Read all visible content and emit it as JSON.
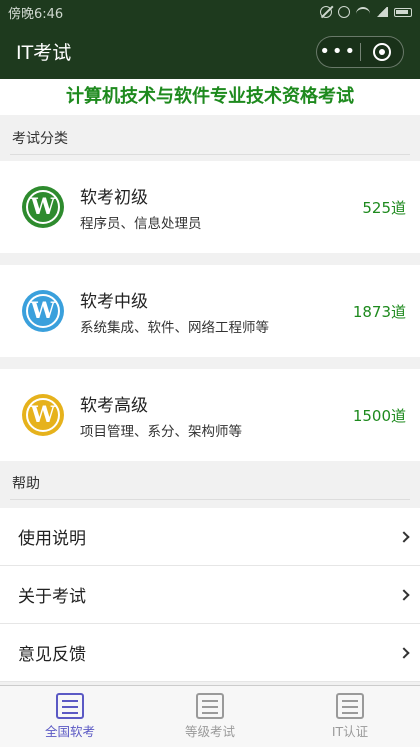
{
  "status": {
    "time": "傍晚6:46"
  },
  "nav": {
    "title": "IT考试",
    "more": "•••"
  },
  "banner": "计算机技术与软件专业技术资格考试",
  "sections": {
    "category": "考试分类",
    "help": "帮助"
  },
  "cards": [
    {
      "title": "软考初级",
      "subtitle": "程序员、信息处理员",
      "count": "525道",
      "color": "#2e8b2e",
      "icon": "wordpress-icon"
    },
    {
      "title": "软考中级",
      "subtitle": "系统集成、软件、网络工程师等",
      "count": "1873道",
      "color": "#3aa0dc",
      "icon": "wordpress-icon"
    },
    {
      "title": "软考高级",
      "subtitle": "项目管理、系分、架构师等",
      "count": "1500道",
      "color": "#e6b21c",
      "icon": "wordpress-icon"
    }
  ],
  "help": [
    {
      "label": "使用说明"
    },
    {
      "label": "关于考试"
    },
    {
      "label": "意见反馈"
    }
  ],
  "tabs": [
    {
      "label": "全国软考",
      "active": true
    },
    {
      "label": "等级考试",
      "active": false
    },
    {
      "label": "IT认证",
      "active": false
    }
  ]
}
